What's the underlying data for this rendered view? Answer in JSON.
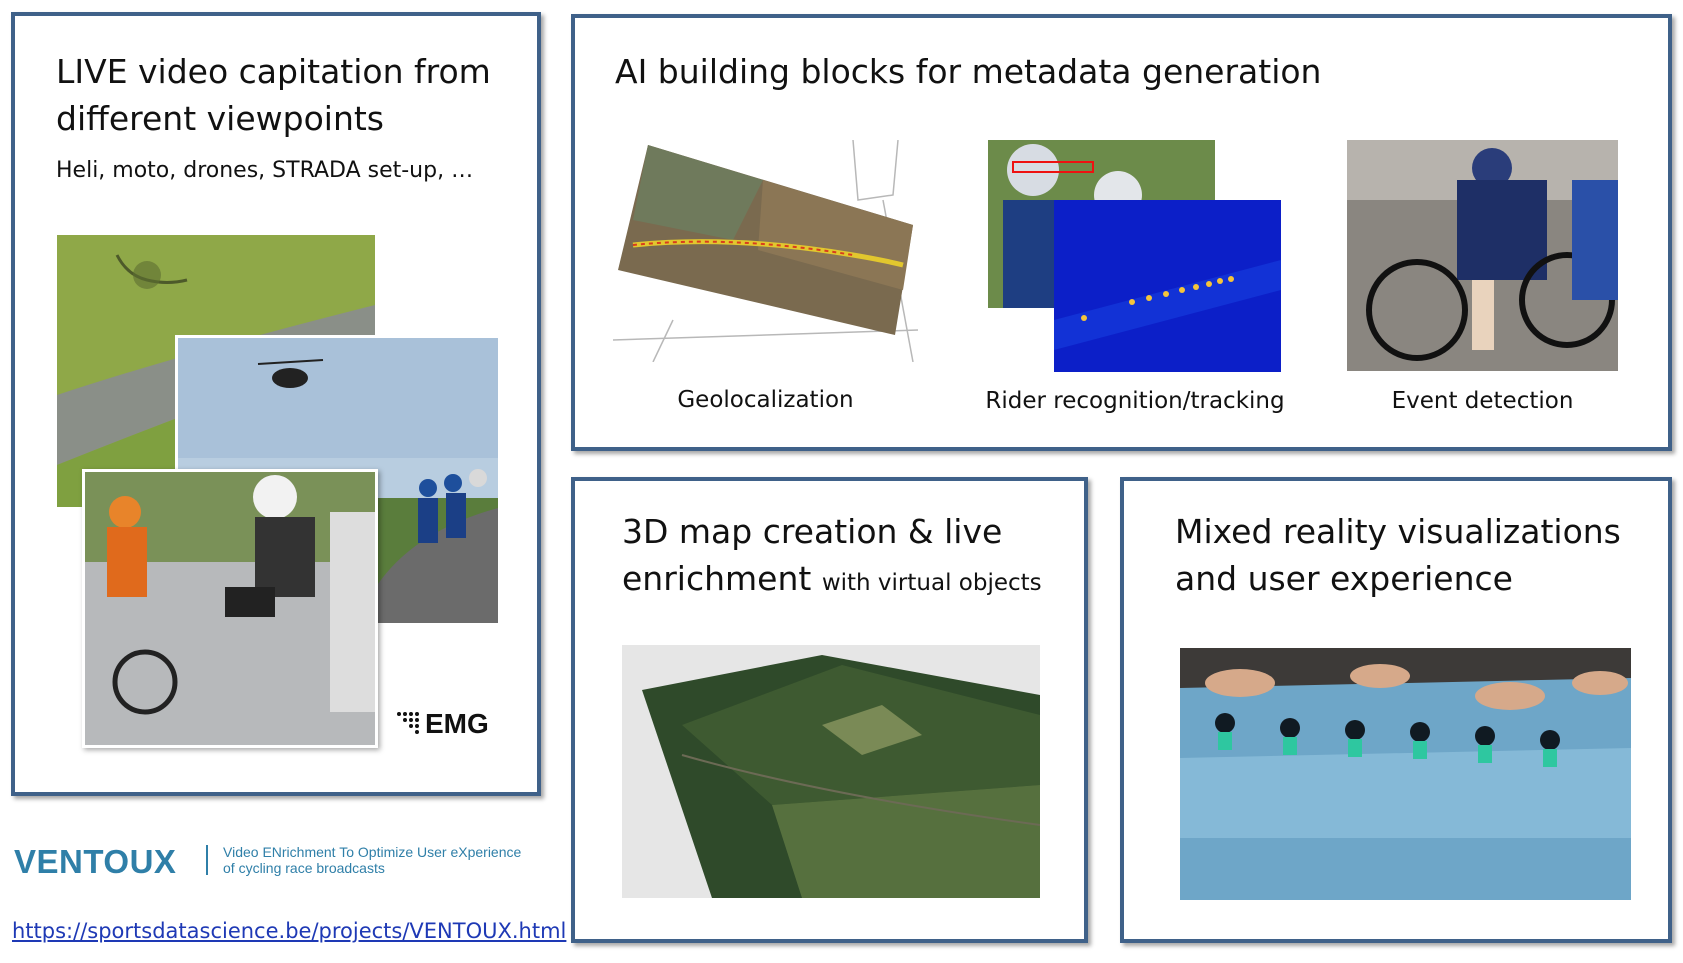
{
  "panel_live": {
    "title": "LIVE video capitation from different viewpoints",
    "subtitle": "Heli, moto, drones, STRADA set-up, …",
    "logo_text": "EMG"
  },
  "panel_ai": {
    "title": "AI building blocks for metadata generation",
    "captions": [
      "Geolocalization",
      "Rider recognition/tracking",
      "Event detection"
    ]
  },
  "panel_3d": {
    "title_main": "3D map creation & live enrichment",
    "title_small": "with virtual objects"
  },
  "panel_mr": {
    "title": "Mixed reality visualizations and user experience"
  },
  "footer": {
    "brand": "VENTOUX",
    "tagline_line1": "Video ENrichment To Optimize User eXperience",
    "tagline_line2": "of cycling race broadcasts",
    "link": "https://sportsdatascience.be/projects/VENTOUX.html"
  },
  "colors": {
    "panel_border": "#3f6189",
    "brand": "#2f7fa8",
    "link": "#1e39b5"
  }
}
